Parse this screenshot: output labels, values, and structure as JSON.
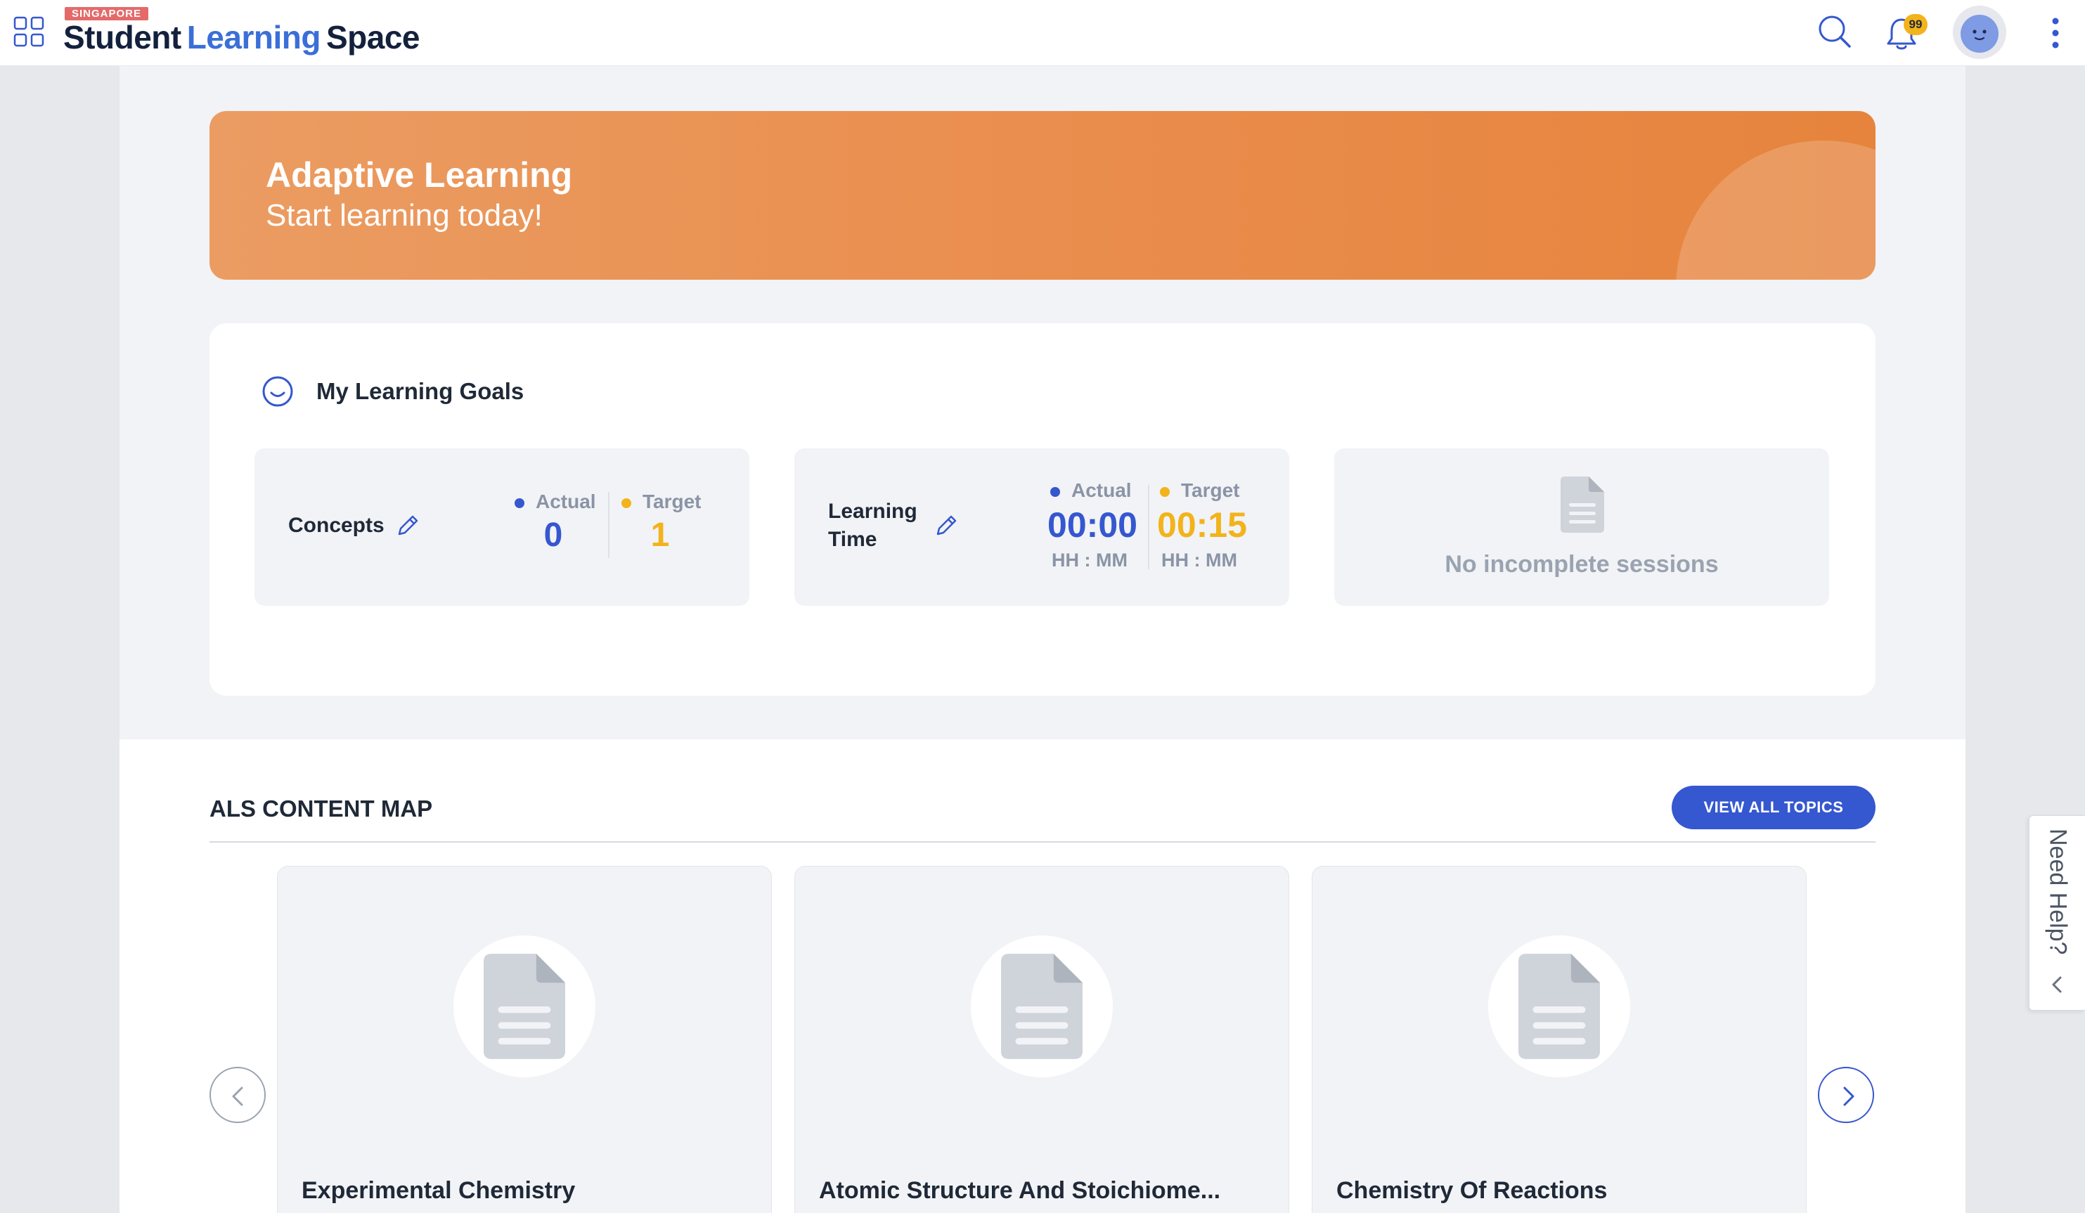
{
  "header": {
    "logo_badge": "SINGAPORE",
    "logo_word1": "Student",
    "logo_word2": "Learning",
    "logo_word3": "Space",
    "notification_count": "99",
    "icons": [
      "apps-grid-icon",
      "search-icon",
      "bell-icon",
      "avatar",
      "more-vertical-icon"
    ]
  },
  "hero": {
    "title": "Adaptive Learning",
    "subtitle": "Start learning today!"
  },
  "goals": {
    "title": "My Learning Goals",
    "concepts": {
      "label": "Concepts",
      "actual_label": "Actual",
      "target_label": "Target",
      "actual_value": "0",
      "target_value": "1"
    },
    "learning_time": {
      "label_line1": "Learning",
      "label_line2": "Time",
      "actual_label": "Actual",
      "target_label": "Target",
      "actual_value": "00:00",
      "target_value": "00:15",
      "actual_unit": "HH : MM",
      "target_unit": "HH : MM"
    },
    "sessions": {
      "empty_text": "No incomplete sessions"
    }
  },
  "content_map": {
    "title": "ALS CONTENT MAP",
    "view_all_label": "VIEW ALL TOPICS",
    "topics": [
      {
        "name": "Experimental Chemistry"
      },
      {
        "name": "Atomic Structure And Stoichiome..."
      },
      {
        "name": "Chemistry Of Reactions"
      }
    ]
  },
  "help": {
    "label": "Need Help?"
  },
  "colors": {
    "primary": "#3557cf",
    "accent_orange": "#e98b4a",
    "target_yellow": "#f2b31b"
  }
}
